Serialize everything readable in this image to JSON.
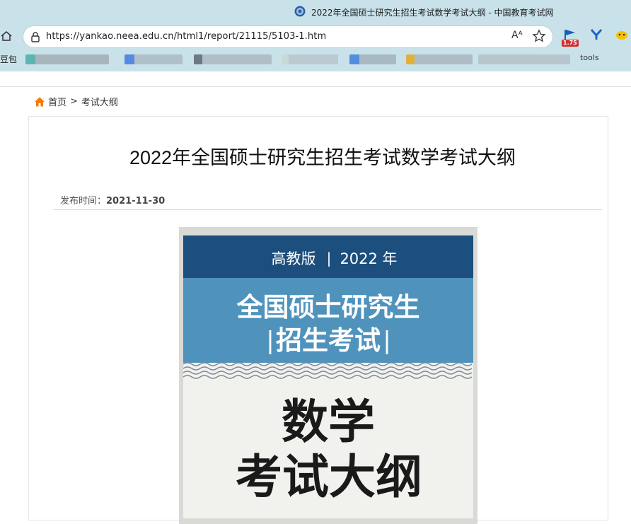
{
  "browser": {
    "tab_title": "2022年全国硕士研究生招生考试数学考试大纲 - 中国教育考试网",
    "url": "https://yankao.neea.edu.cn/html1/report/21115/5103-1.htm",
    "read_aloud_label": "Aᴬ",
    "extension_badge": "1.75",
    "bookmarks_first": "豆包",
    "bookmarks_last": "tools"
  },
  "breadcrumb": {
    "home": "首页",
    "separator": ">",
    "current": "考试大纲"
  },
  "article": {
    "title": "2022年全国硕士研究生招生考试数学考试大纲",
    "publish_label": "发布时间：",
    "publish_date": "2021-11-30"
  },
  "cover": {
    "edition": "高教版",
    "divider": "|",
    "year": "2022 年",
    "line1": "全国硕士研究生",
    "line2": "招生考试",
    "bar_left": "|",
    "bar_right": "|",
    "subject": "数学",
    "doc_type": "考试大纲"
  },
  "colors": {
    "chrome_bg": "#c9e2ea",
    "cover_dark_blue": "#1c4e7e",
    "cover_light_blue": "#4f93bd",
    "home_icon": "#f57c00"
  }
}
